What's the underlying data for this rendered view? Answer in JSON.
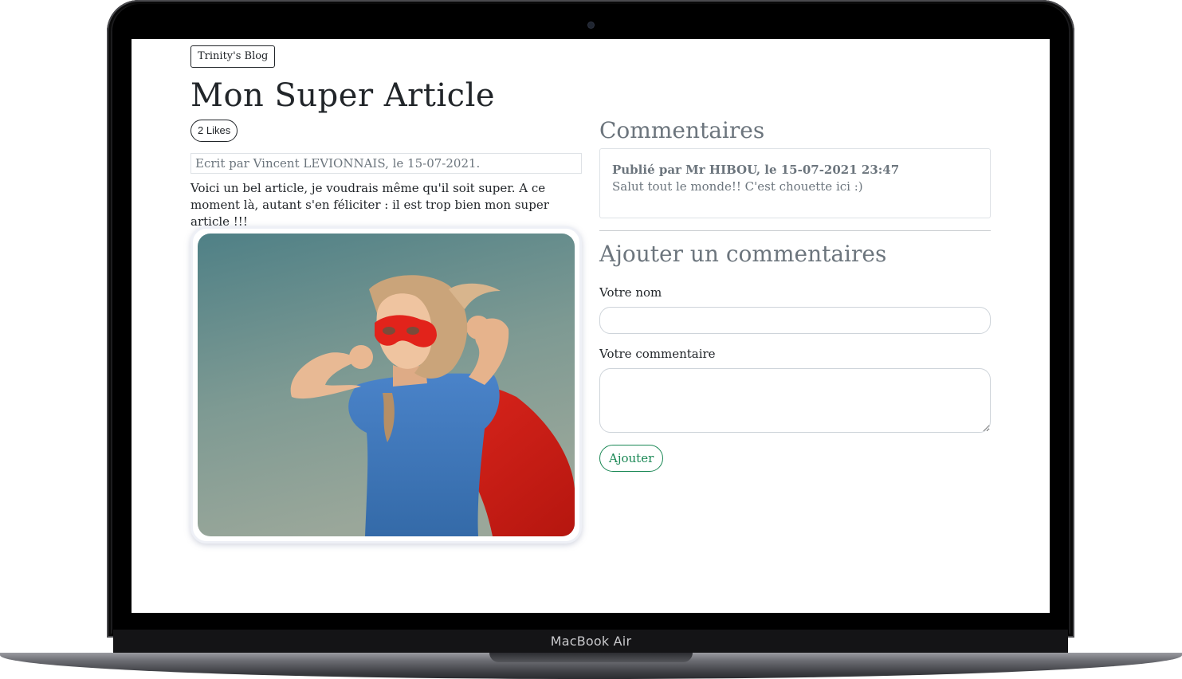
{
  "device": {
    "brand_label": "MacBook Air"
  },
  "navbar": {
    "brand": "Trinity's Blog"
  },
  "article": {
    "title": "Mon Super Article",
    "likes_label": "2 Likes",
    "byline": "Ecrit par Vincent LEVIONNAIS, le 15-07-2021.",
    "body": "Voici un bel article, je voudrais même qu'il soit super. A ce moment là, autant s'en féliciter : il est trop bien mon super article !!!"
  },
  "comments": {
    "title": "Commentaires",
    "items": [
      {
        "meta": "Publié par Mr HIBOU, le 15-07-2021 23:47",
        "text": "Salut tout le monde!! C'est chouette ici :)"
      }
    ]
  },
  "add_comment": {
    "title": "Ajouter un commentaires",
    "name_label": "Votre nom",
    "name_value": "",
    "comment_label": "Votre commentaire",
    "comment_value": "",
    "submit_label": "Ajouter"
  },
  "colors": {
    "text": "#212529",
    "muted": "#6c757d",
    "success": "#198754",
    "border": "#dee2e6"
  }
}
